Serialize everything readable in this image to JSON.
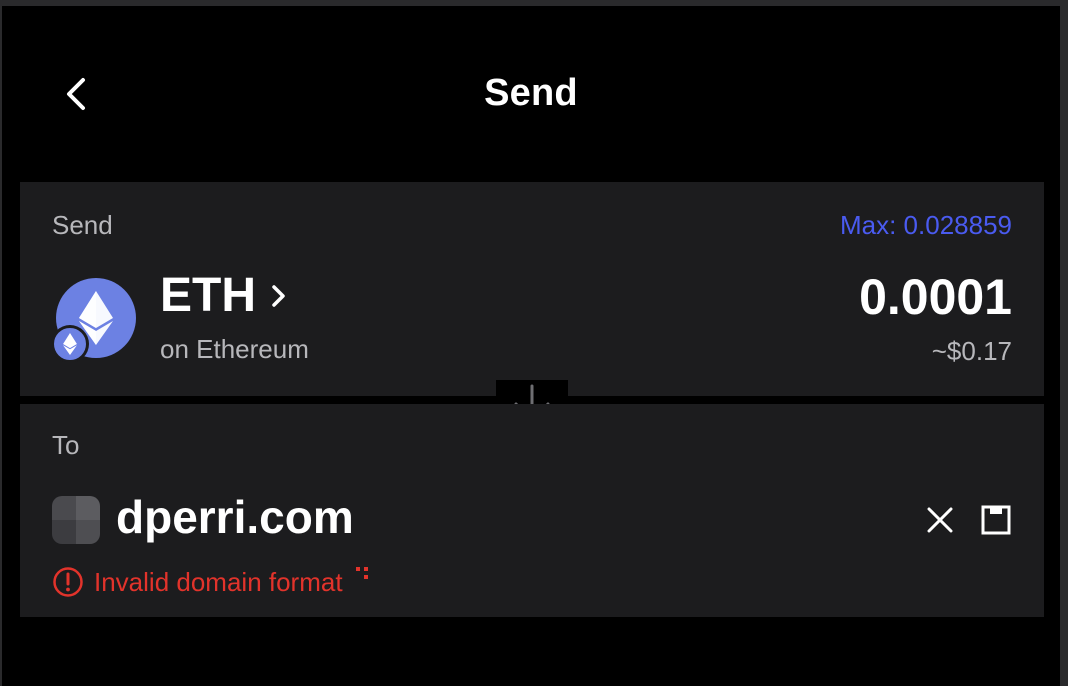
{
  "header": {
    "title": "Send",
    "back_icon": "chevron-left-icon"
  },
  "send_section": {
    "label": "Send",
    "max_label": "Max: 0.028859",
    "token": {
      "symbol": "ETH",
      "network": "on Ethereum",
      "icon": "ethereum-icon",
      "color": "#6c81e3"
    },
    "amount": "0.0001",
    "fiat_value": "~$0.17"
  },
  "to_section": {
    "label": "To",
    "recipient": "dperri.com",
    "error_message": "Invalid domain format"
  },
  "colors": {
    "accent": "#4a5bf0",
    "error": "#e2332b",
    "card": "#1c1c1e",
    "background": "#000000"
  }
}
